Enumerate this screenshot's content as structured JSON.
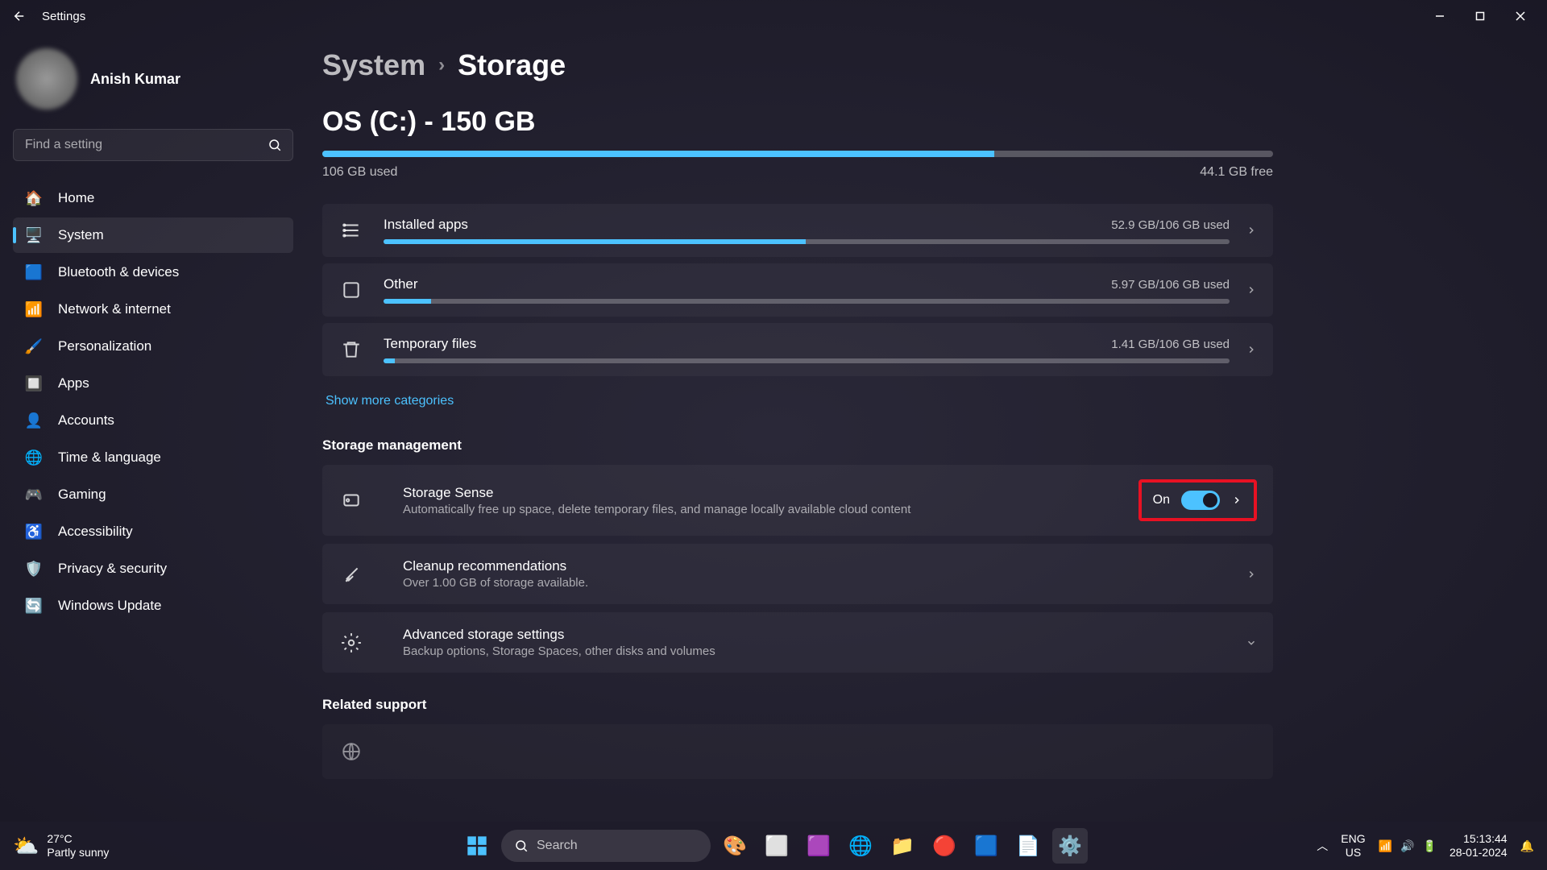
{
  "titlebar": {
    "title": "Settings"
  },
  "user": {
    "name": "Anish Kumar"
  },
  "search": {
    "placeholder": "Find a setting"
  },
  "nav": [
    {
      "label": "Home",
      "icon": "🏠"
    },
    {
      "label": "System",
      "icon": "🖥️",
      "active": true
    },
    {
      "label": "Bluetooth & devices",
      "icon": "🟦"
    },
    {
      "label": "Network & internet",
      "icon": "📶"
    },
    {
      "label": "Personalization",
      "icon": "🖌️"
    },
    {
      "label": "Apps",
      "icon": "🔲"
    },
    {
      "label": "Accounts",
      "icon": "👤"
    },
    {
      "label": "Time & language",
      "icon": "🌐"
    },
    {
      "label": "Gaming",
      "icon": "🎮"
    },
    {
      "label": "Accessibility",
      "icon": "♿"
    },
    {
      "label": "Privacy & security",
      "icon": "🛡️"
    },
    {
      "label": "Windows Update",
      "icon": "🔄"
    }
  ],
  "breadcrumb": {
    "parent": "System",
    "current": "Storage"
  },
  "drive": {
    "title": "OS (C:) - 150 GB",
    "used_label": "106 GB used",
    "free_label": "44.1 GB free",
    "fill_pct": 70.7
  },
  "categories": [
    {
      "name": "Installed apps",
      "usage": "52.9 GB/106 GB used",
      "fill_pct": 49.9
    },
    {
      "name": "Other",
      "usage": "5.97 GB/106 GB used",
      "fill_pct": 5.6
    },
    {
      "name": "Temporary files",
      "usage": "1.41 GB/106 GB used",
      "fill_pct": 1.3
    }
  ],
  "show_more": "Show more categories",
  "mgmt_section": "Storage management",
  "storage_sense": {
    "title": "Storage Sense",
    "sub": "Automatically free up space, delete temporary files, and manage locally available cloud content",
    "state": "On"
  },
  "cleanup": {
    "title": "Cleanup recommendations",
    "sub": "Over 1.00 GB of storage available."
  },
  "advanced": {
    "title": "Advanced storage settings",
    "sub": "Backup options, Storage Spaces, other disks and volumes"
  },
  "related_section": "Related support",
  "taskbar": {
    "weather_temp": "27°C",
    "weather_desc": "Partly sunny",
    "search_placeholder": "Search",
    "lang_top": "ENG",
    "lang_bot": "US",
    "time": "15:13:44",
    "date": "28-01-2024"
  }
}
